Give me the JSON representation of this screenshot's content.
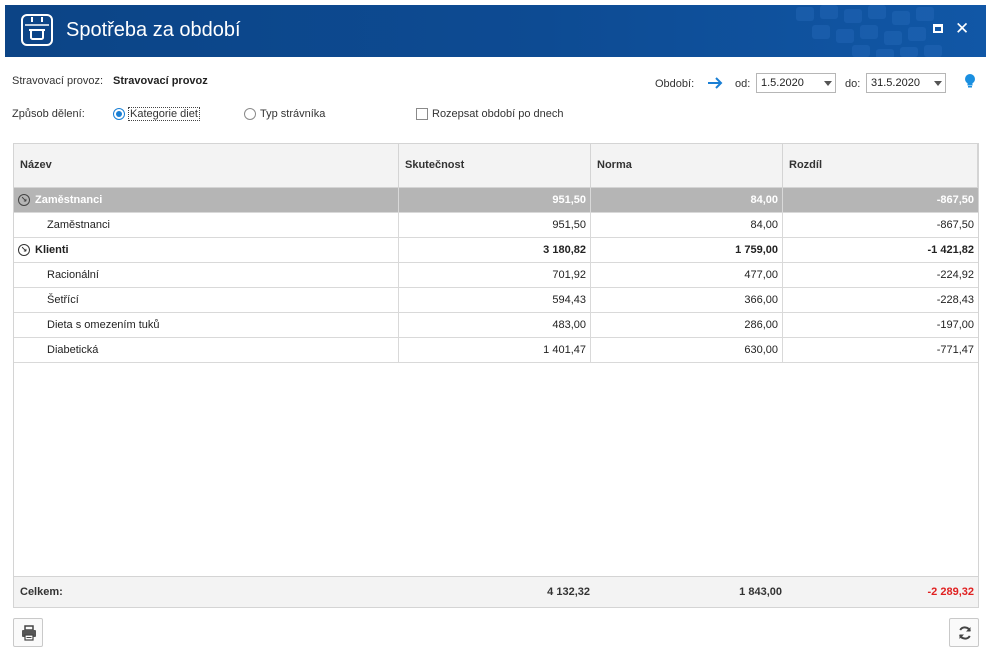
{
  "window": {
    "title": "Spotřeba za období",
    "app_icon": "calendar-pot-icon"
  },
  "form": {
    "provoz_label": "Stravovací provoz:",
    "provoz_value": "Stravovací provoz",
    "obdobi_label": "Období:",
    "od_label": "od:",
    "od_value": "1.5.2020",
    "do_label": "do:",
    "do_value": "31.5.2020",
    "zpusob_label": "Způsob dělení:",
    "radio_kategorie": "Kategorie diet",
    "radio_typ": "Typ strávníka",
    "selected_radio": "Kategorie diet",
    "checkbox_rozpsat": "Rozepsat období po dnech",
    "checkbox_checked": false
  },
  "grid": {
    "columns": [
      "Název",
      "Skutečnost",
      "Norma",
      "Rozdíl"
    ],
    "rows": [
      {
        "type": "group",
        "name": "Zaměstnanci",
        "skutecnost": "951,50",
        "norma": "84,00",
        "rozdil": "-867,50",
        "selected": true
      },
      {
        "type": "item",
        "name": "Zaměstnanci",
        "skutecnost": "951,50",
        "norma": "84,00",
        "rozdil": "-867,50"
      },
      {
        "type": "group",
        "name": "Klienti",
        "skutecnost": "3 180,82",
        "norma": "1 759,00",
        "rozdil": "-1 421,82"
      },
      {
        "type": "item",
        "name": "Racionální",
        "skutecnost": "701,92",
        "norma": "477,00",
        "rozdil": "-224,92"
      },
      {
        "type": "item",
        "name": "Šetřící",
        "skutecnost": "594,43",
        "norma": "366,00",
        "rozdil": "-228,43"
      },
      {
        "type": "item",
        "name": "Dieta s omezením tuků",
        "skutecnost": "483,00",
        "norma": "286,00",
        "rozdil": "-197,00"
      },
      {
        "type": "item",
        "name": "Diabetická",
        "skutecnost": "1 401,47",
        "norma": "630,00",
        "rozdil": "-771,47"
      }
    ],
    "footer": {
      "label": "Celkem:",
      "skutecnost": "4 132,32",
      "norma": "1 843,00",
      "rozdil": "-2 289,32"
    }
  },
  "colors": {
    "titlebar": "#0d4b93",
    "accent": "#1a7fd4",
    "negative_total": "#e02020",
    "group_row": "#b5b5b5"
  }
}
